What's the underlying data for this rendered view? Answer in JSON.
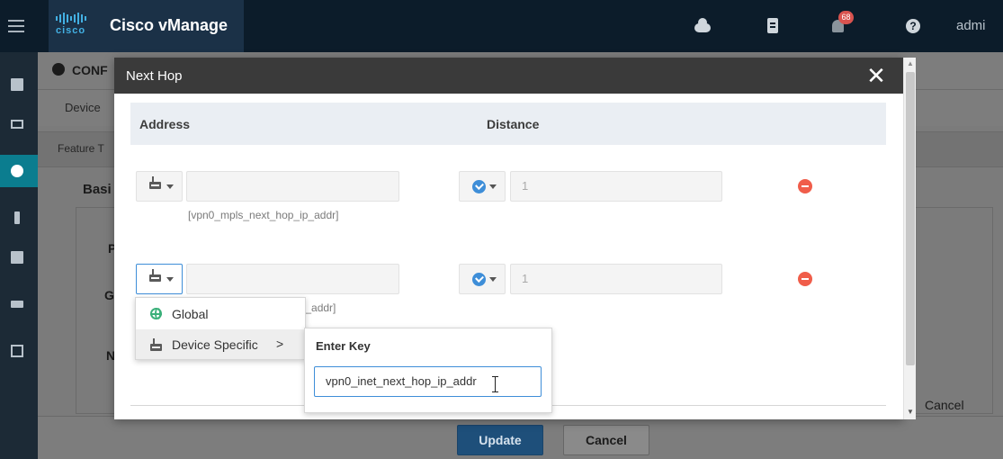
{
  "app": {
    "logo_text": "cisco",
    "title": "Cisco vManage",
    "notification_count": "68",
    "help_glyph": "?",
    "user": "admi"
  },
  "icons": {
    "menu": "hamburger-icon",
    "cloud": "cloud-icon",
    "tasks": "clipboard-icon",
    "alerts": "bell-icon",
    "help": "help-icon",
    "remove": "minus-circle-icon",
    "global": "globe-icon",
    "device": "router-icon",
    "default": "check-circle-icon",
    "close": "close-icon"
  },
  "background": {
    "breadcrumb": "CONF",
    "tab_device": "Device",
    "tab_feature": "Feature T",
    "section_basic": "Basi",
    "field_p": "P",
    "field_g": "G",
    "field_n": "N",
    "cancel_link": "Cancel",
    "update_button": "Update",
    "cancel_button": "Cancel"
  },
  "modal": {
    "title": "Next Hop",
    "close_glyph": "✕",
    "columns": {
      "address": "Address",
      "distance": "Distance"
    },
    "rows": [
      {
        "address_value": "",
        "address_hint": "[vpn0_mpls_next_hop_ip_addr]",
        "distance_placeholder": "1"
      },
      {
        "address_value": "",
        "address_hint": "ip_addr]",
        "distance_placeholder": "1"
      }
    ]
  },
  "dropdown": {
    "items": [
      {
        "label": "Global",
        "icon": "globe-icon"
      },
      {
        "label": "Device Specific",
        "icon": "router-icon",
        "chevron": ">"
      }
    ]
  },
  "submenu": {
    "title": "Enter Key",
    "key_value": "vpn0_inet_next_hop_ip_addr"
  },
  "colors": {
    "topbar": "#0c1c2a",
    "brand": "#1b3147",
    "accent": "#3e8ed8",
    "active_nav": "#0b7d8f",
    "remove": "#f05d4a",
    "badge": "#d9534f"
  }
}
